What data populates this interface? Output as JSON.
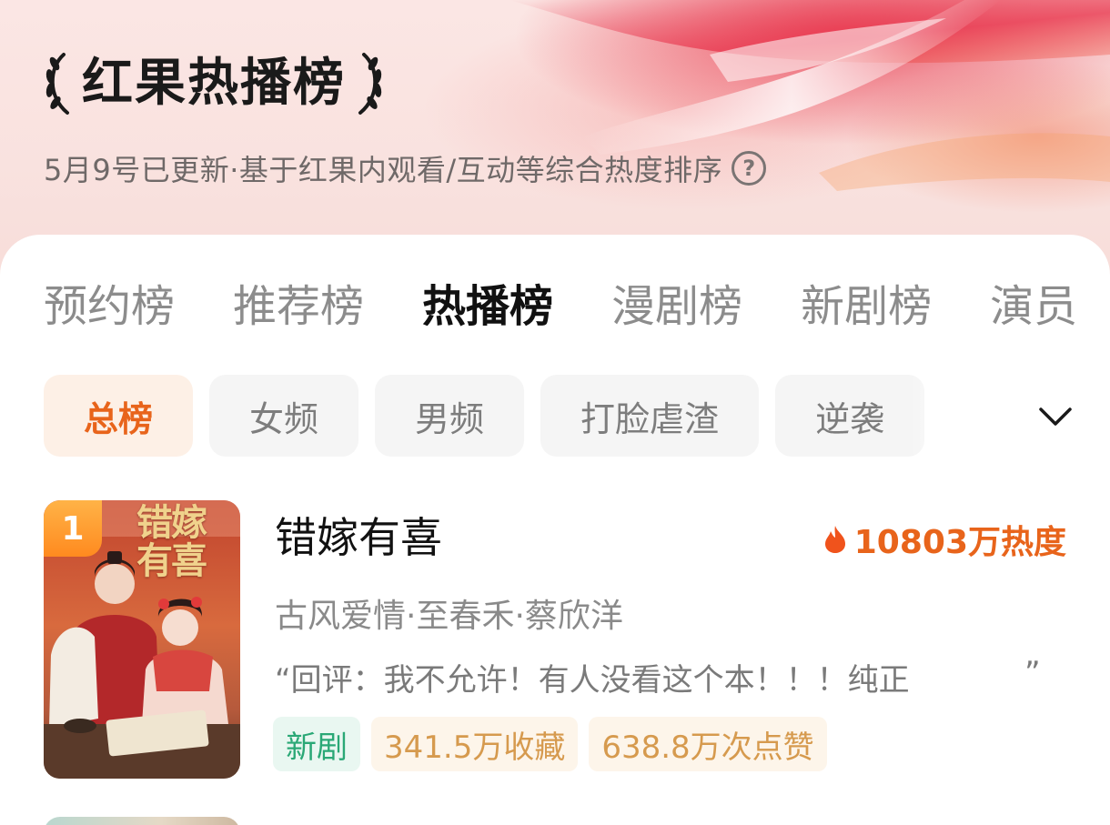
{
  "header": {
    "title": "红果热播榜",
    "subtitle": "5月9号已更新·基于红果内观看/互动等综合热度排序",
    "help_symbol": "?"
  },
  "tabs": [
    {
      "label": "预约榜",
      "active": false
    },
    {
      "label": "推荐榜",
      "active": false
    },
    {
      "label": "热播榜",
      "active": true
    },
    {
      "label": "漫剧榜",
      "active": false
    },
    {
      "label": "新剧榜",
      "active": false
    },
    {
      "label": "演员",
      "active": false
    }
  ],
  "chips": [
    {
      "label": "总榜",
      "active": true
    },
    {
      "label": "女频",
      "active": false
    },
    {
      "label": "男频",
      "active": false
    },
    {
      "label": "打脸虐渣",
      "active": false
    },
    {
      "label": "逆袭",
      "active": false
    }
  ],
  "items": [
    {
      "rank": "1",
      "poster_title": "错嫁有喜",
      "title": "错嫁有喜",
      "heat": "10803万热度",
      "meta": "古风爱情·至春禾·蔡欣洋",
      "quote": "“回评：我不允许！有人没看这个本！！！纯正",
      "quote_end": "”",
      "tags": {
        "new": "新剧",
        "favorites": "341.5万收藏",
        "likes": "638.8万次点赞"
      }
    }
  ],
  "colors": {
    "accent": "#e8641b",
    "new_tag": "#2aa876",
    "stat_tag": "#d69a4e",
    "rank_badge": "#ff8a1f"
  },
  "icons": [
    "laurel-left-icon",
    "laurel-right-icon",
    "help-icon",
    "chevron-down-icon",
    "fire-icon"
  ]
}
